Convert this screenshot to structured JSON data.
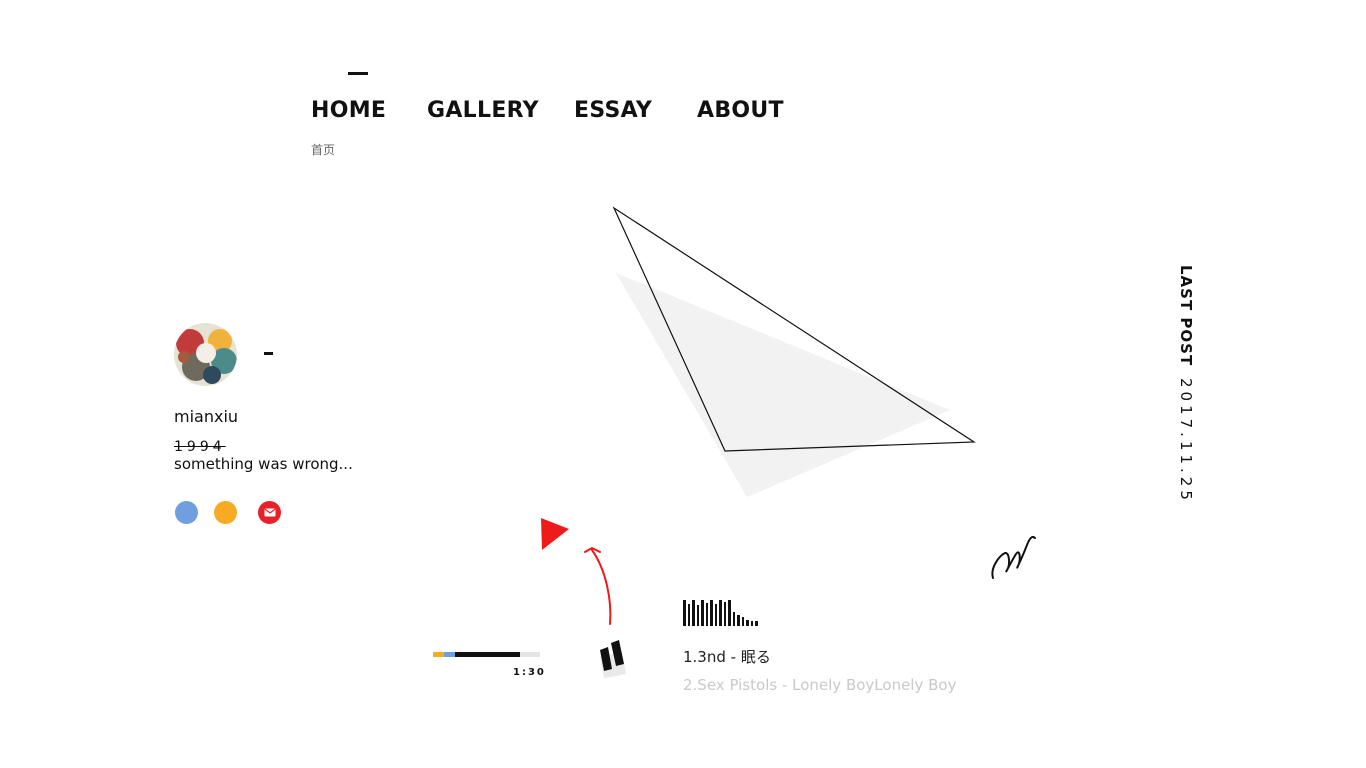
{
  "nav": {
    "items": [
      {
        "label": "HOME"
      },
      {
        "label": "GALLERY"
      },
      {
        "label": "ESSAY"
      },
      {
        "label": "ABOUT"
      }
    ],
    "subtitle": "首页"
  },
  "profile": {
    "username": "mianxiu",
    "year": "1994",
    "bio": "something was wrong..."
  },
  "social": {
    "colors": [
      "#6f9fde",
      "#f7ab22",
      "#e8202a"
    ],
    "icons": [
      "circle-icon",
      "circle-icon",
      "mail-icon"
    ]
  },
  "last_post": {
    "label": "LAST POST",
    "date": "2017.11.25"
  },
  "player": {
    "time": "1:30",
    "progress": 0.81,
    "accent_colors": [
      "#f7ab22",
      "#6f9fde",
      "#111111"
    ],
    "tracks": [
      {
        "label": "1.3nd - 眠る"
      },
      {
        "label": "2.Sex Pistols - Lonely BoyLonely Boy"
      }
    ]
  },
  "colors": {
    "accent_red": "#ef1a1a",
    "triangle_fill": "#f2f2f2"
  }
}
